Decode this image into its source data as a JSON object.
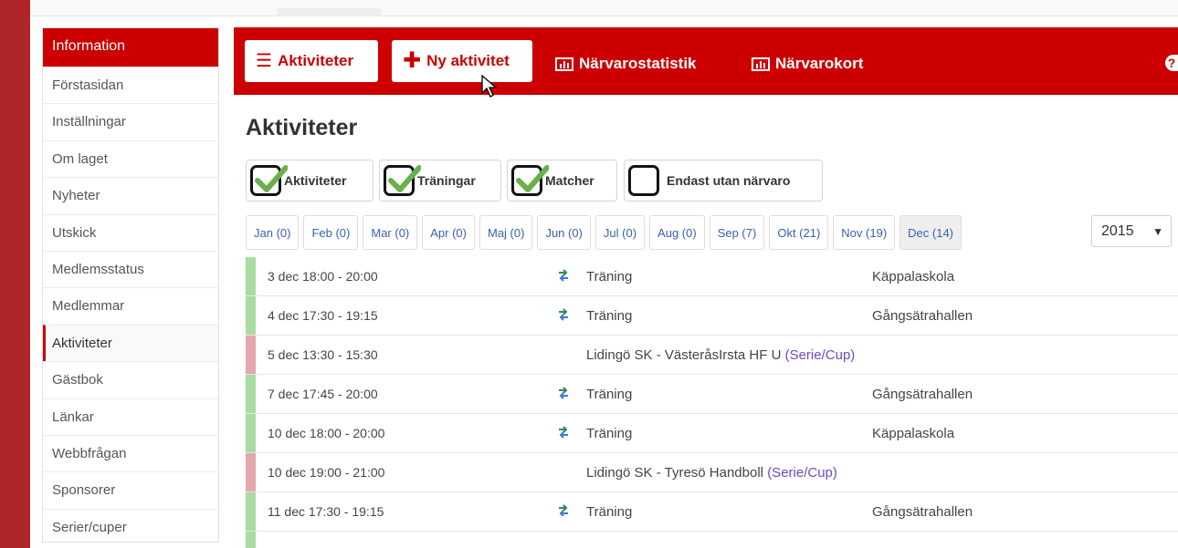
{
  "sidebar": {
    "header": "Information",
    "items": [
      "Förstasidan",
      "Inställningar",
      "Om laget",
      "Nyheter",
      "Utskick",
      "Medlemsstatus",
      "Medlemmar",
      "Aktiviteter",
      "Gästbok",
      "Länkar",
      "Webbfrågan",
      "Sponsorer",
      "Serier/cuper"
    ],
    "active_index": 7
  },
  "toolbar": {
    "activities_label": "Aktiviteter",
    "new_activity_label": "Ny aktivitet",
    "attendance_stats_label": "Närvarostatistik",
    "attendance_card_label": "Närvarokort",
    "help_label": "?"
  },
  "page": {
    "title": "Aktiviteter"
  },
  "filters": [
    {
      "label": "Aktiviteter",
      "checked": true
    },
    {
      "label": "Träningar",
      "checked": true
    },
    {
      "label": "Matcher",
      "checked": true
    },
    {
      "label": "Endast utan närvaro",
      "checked": false
    }
  ],
  "months": [
    {
      "label": "Jan (0)"
    },
    {
      "label": "Feb (0)"
    },
    {
      "label": "Mar (0)"
    },
    {
      "label": "Apr (0)"
    },
    {
      "label": "Maj (0)"
    },
    {
      "label": "Jun (0)"
    },
    {
      "label": "Jul (0)"
    },
    {
      "label": "Aug (0)"
    },
    {
      "label": "Sep (7)"
    },
    {
      "label": "Okt (21)"
    },
    {
      "label": "Nov (19)"
    },
    {
      "label": "Dec (14)"
    }
  ],
  "active_month": "Dec (14)",
  "year": {
    "selected": "2015",
    "arrow": "▼"
  },
  "activities": [
    {
      "date": "3 dec 18:00 - 20:00",
      "kind": "training",
      "type": "Träning",
      "place": "Käppalaskola"
    },
    {
      "date": "4 dec 17:30 - 19:15",
      "kind": "training",
      "type": "Träning",
      "place": "Gångsätrahallen"
    },
    {
      "date": "5 dec 13:30 - 15:30",
      "kind": "match",
      "type": "Lidingö SK - VästeråsIrsta HF U",
      "link": "(Serie/Cup)"
    },
    {
      "date": "7 dec 17:45 - 20:00",
      "kind": "training",
      "type": "Träning",
      "place": "Gångsätrahallen"
    },
    {
      "date": "10 dec 18:00 - 20:00",
      "kind": "training",
      "type": "Träning",
      "place": "Käppalaskola"
    },
    {
      "date": "10 dec 19:00 - 21:00",
      "kind": "match",
      "type": "Lidingö SK - Tyresö Handboll",
      "link": "(Serie/Cup)"
    },
    {
      "date": "11 dec 17:30 - 19:15",
      "kind": "training",
      "type": "Träning",
      "place": "Gångsätrahallen"
    }
  ],
  "colors": {
    "brand_red": "#cc0000",
    "training_bar": "#a8dca0",
    "match_bar": "#e3a8ab",
    "link": "#6a4bbf",
    "month_link": "#3a5fb0"
  }
}
